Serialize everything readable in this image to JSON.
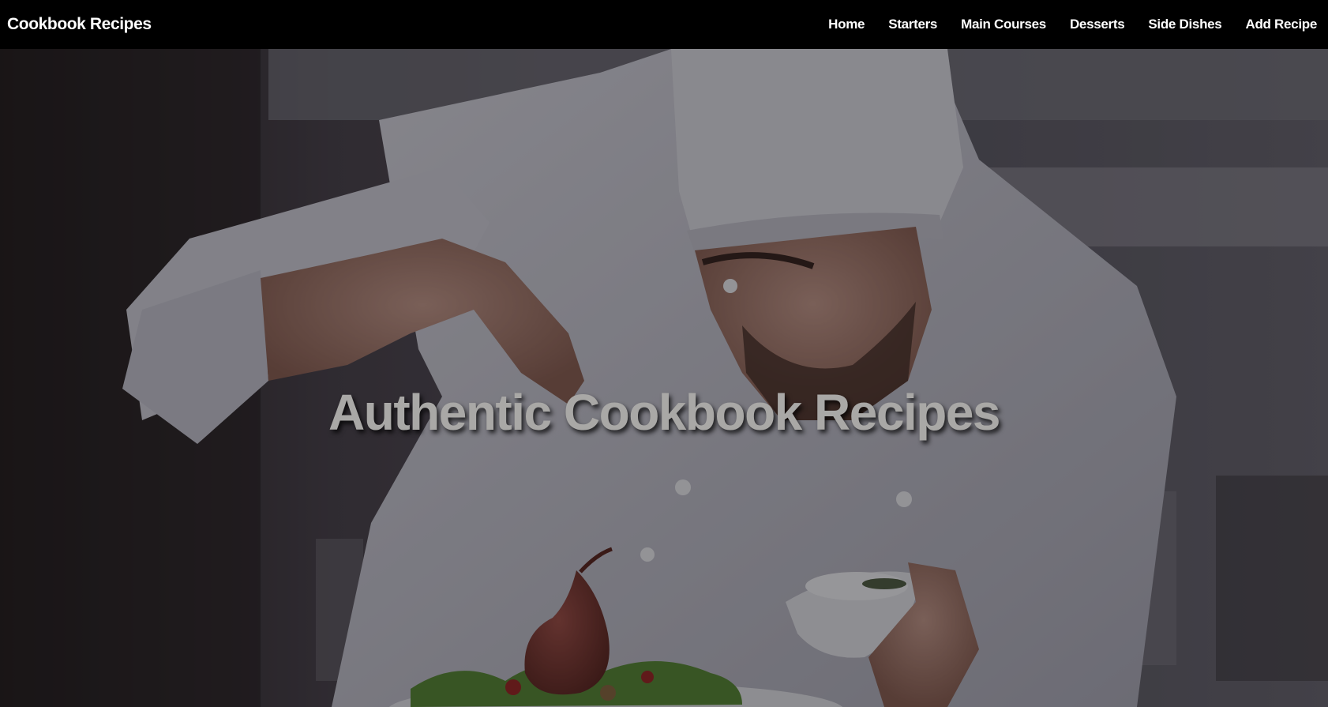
{
  "nav": {
    "brand": "Cookbook Recipes",
    "links": [
      {
        "label": "Home"
      },
      {
        "label": "Starters"
      },
      {
        "label": "Main Courses"
      },
      {
        "label": "Desserts"
      },
      {
        "label": "Side Dishes"
      },
      {
        "label": "Add Recipe"
      }
    ]
  },
  "hero": {
    "title": "Authentic Cookbook Recipes",
    "image_subject": "chef-seasoning-plated-dish"
  },
  "colors": {
    "navbar_background": "#000000",
    "nav_text": "#ffffff",
    "hero_title": "#a9a8a6",
    "hero_overlay": "rgba(0,0,0,0.45)"
  }
}
